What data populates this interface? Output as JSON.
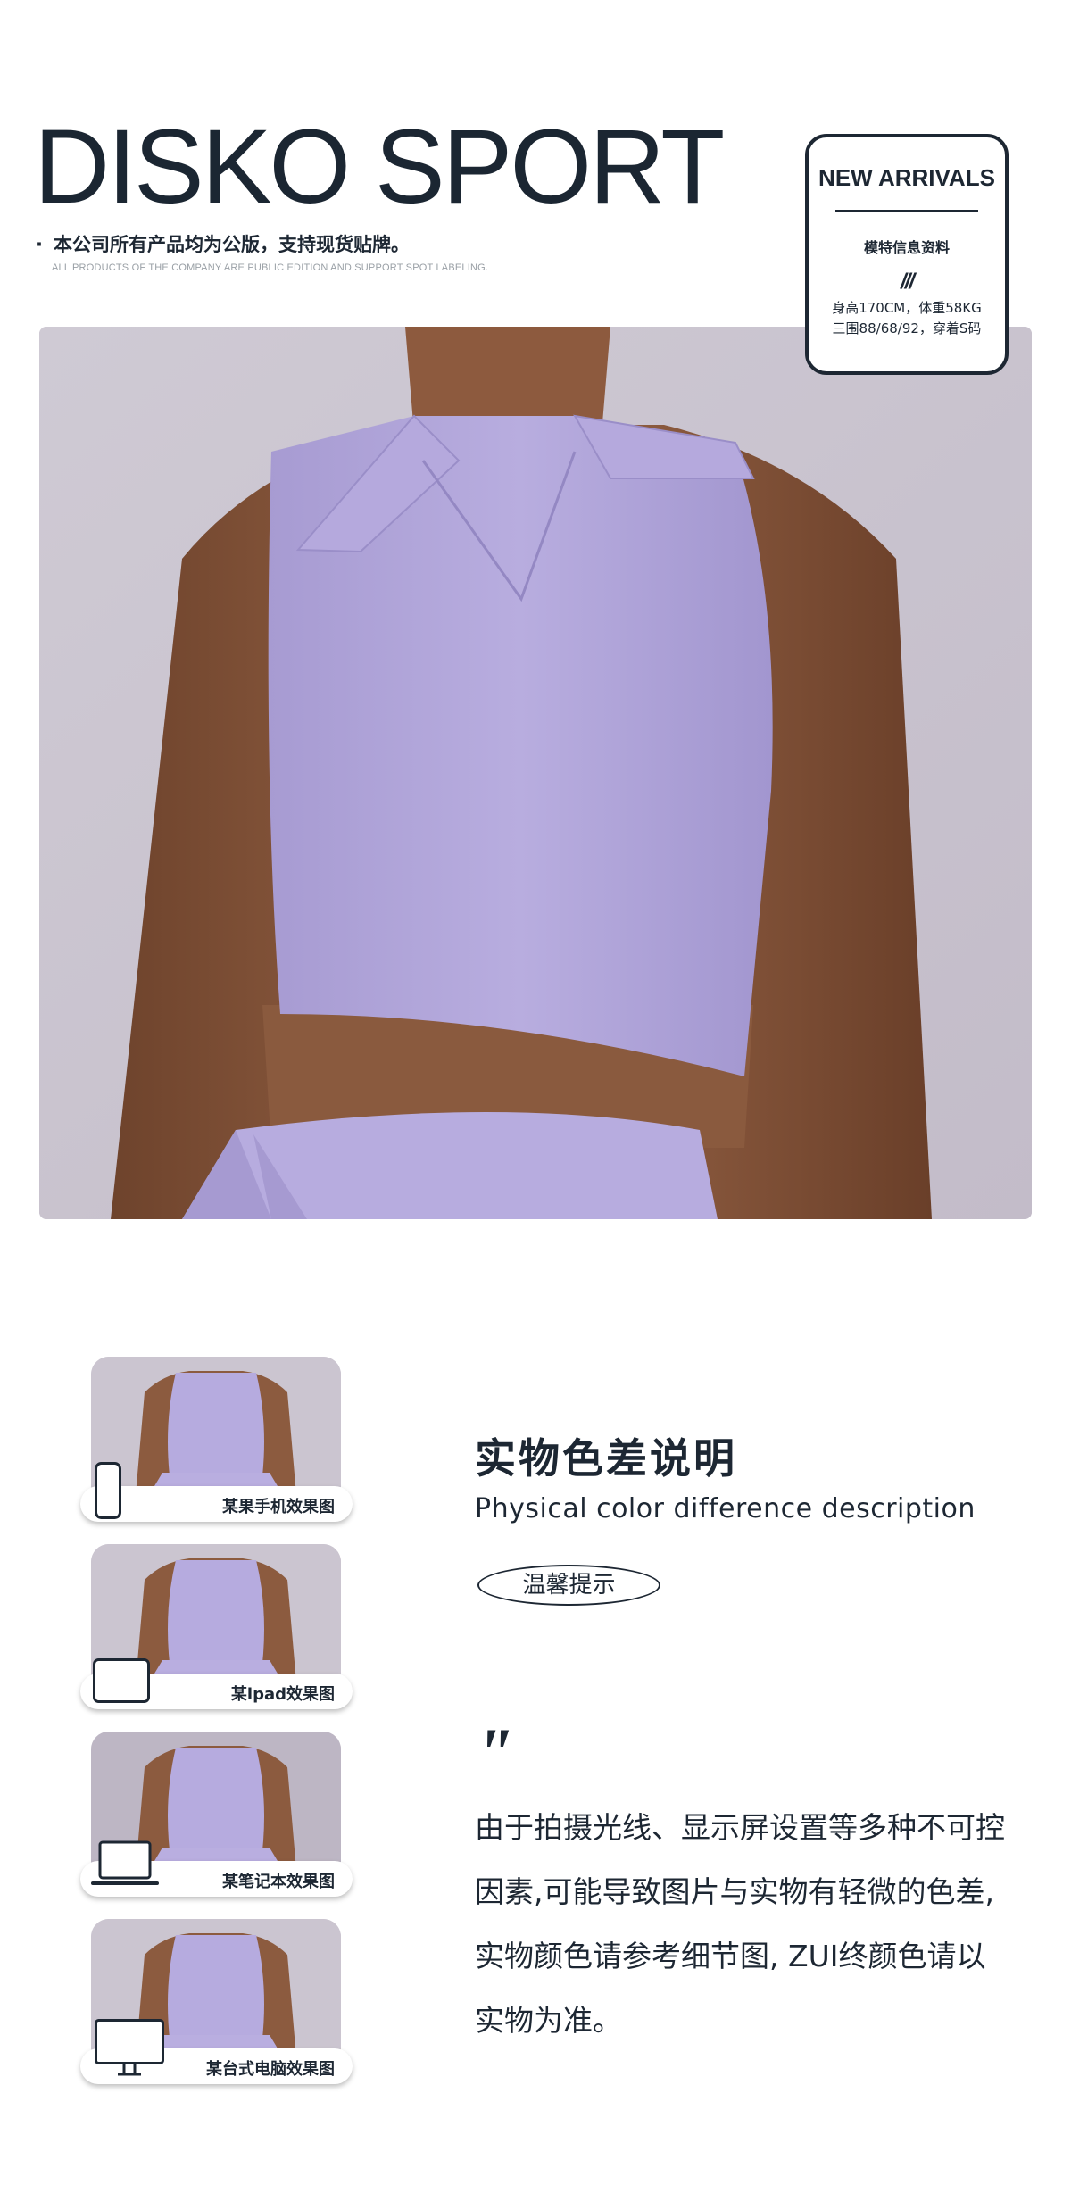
{
  "header": {
    "brand": "DISKO SPORT",
    "notice_bullet": "·",
    "notice_cn": "本公司所有产品均为公版，支持现货贴牌。",
    "notice_en": "ALL PRODUCTS OF THE COMPANY ARE PUBLIC EDITION AND SUPPORT SPOT LABELING."
  },
  "arrivals": {
    "title": "NEW ARRIVALS",
    "subtitle": "模特信息资料",
    "slashes": "///",
    "line1": "身高170CM，体重58KG",
    "line2": "三围88/68/92，穿着S码"
  },
  "colors": {
    "text_dark": "#1d2733",
    "garment_lavender": "#b4a8dc",
    "background_grey": "#c8c2cd",
    "skin": "#8a5a3e"
  },
  "thumbnails": [
    {
      "label": "某果手机效果图",
      "device": "phone-icon"
    },
    {
      "label": "某ipad效果图",
      "device": "tablet-icon"
    },
    {
      "label": "某笔记本效果图",
      "device": "laptop-icon"
    },
    {
      "label": "某台式电脑效果图",
      "device": "desktop-monitor-icon"
    }
  ],
  "color_diff": {
    "title": "实物色差说明",
    "subtitle": "Physical color difference description",
    "tip": "温馨提示",
    "quote": "\"",
    "lines": [
      "由于拍摄光线、显示屏设置等多种不可控",
      "因素,可能导致图片与实物有轻微的色差,",
      "实物颜色请参考细节图, ZUI终颜色请以",
      "实物为准。"
    ]
  }
}
